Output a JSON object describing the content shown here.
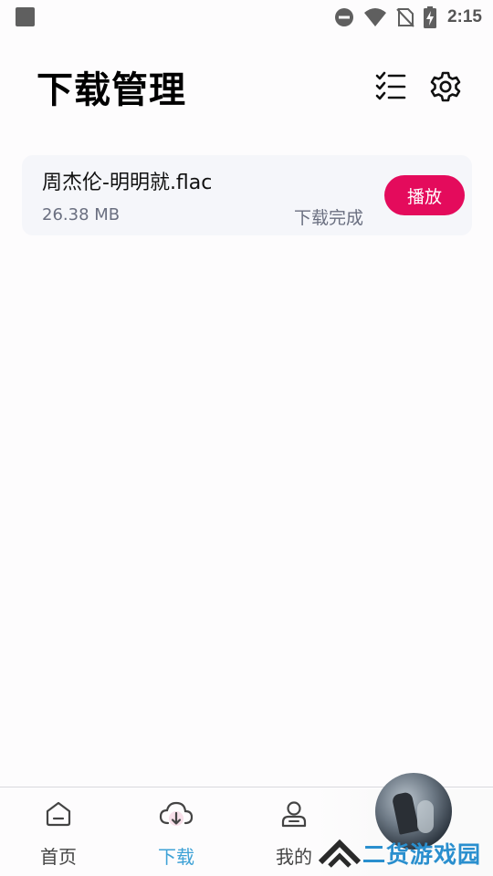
{
  "status_bar": {
    "time": "2:15",
    "icons": [
      "notification-square-icon",
      "do-not-disturb-icon",
      "wifi-icon",
      "no-sim-icon",
      "battery-charging-icon"
    ]
  },
  "header": {
    "title": "下载管理",
    "icons": [
      "checklist-icon",
      "gear-icon"
    ]
  },
  "downloads": [
    {
      "name": "周杰伦-明明就.flac",
      "size": "26.38 MB",
      "status": "下载完成",
      "action": "播放"
    }
  ],
  "bottom_nav": {
    "items": [
      {
        "label": "首页",
        "icon": "home-icon",
        "active": false
      },
      {
        "label": "下载",
        "icon": "cloud-download-icon",
        "active": true
      },
      {
        "label": "我的",
        "icon": "user-icon",
        "active": false
      }
    ]
  },
  "watermark": {
    "text": "二货游戏园"
  },
  "colors": {
    "accent": "#e40b5c",
    "active_nav": "#3fa2d6",
    "card_bg": "#f5f6fa",
    "secondary_text": "#6a6f80",
    "background": "#fdfcfd"
  }
}
